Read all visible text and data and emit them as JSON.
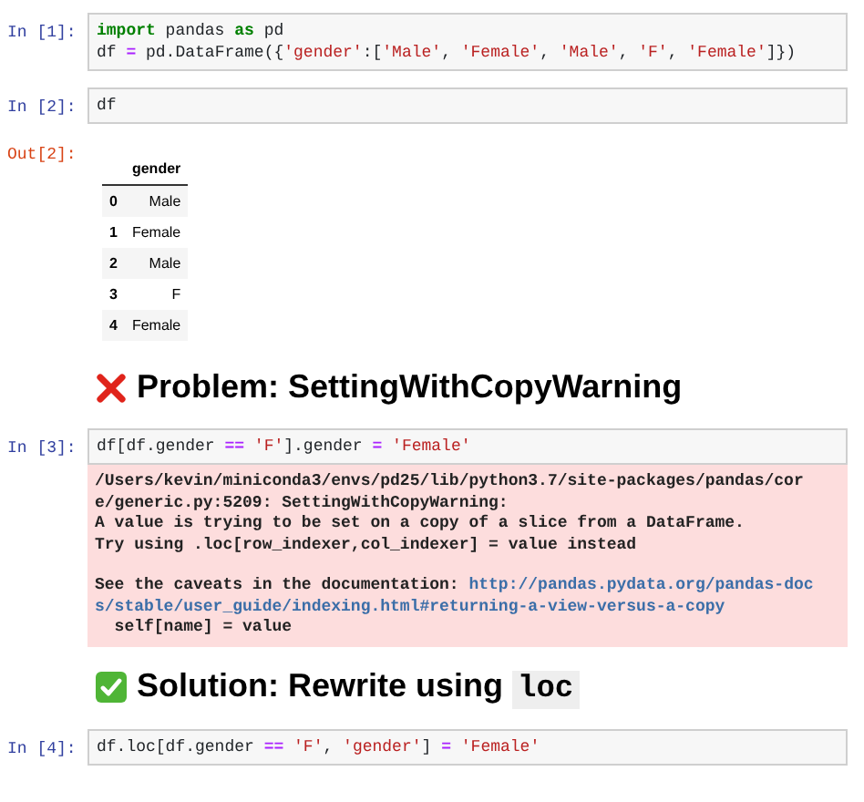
{
  "cells": [
    {
      "kind": "code",
      "prompt": "In [1]:",
      "lines": [
        [
          {
            "text": "import",
            "kind": "keyword"
          },
          {
            "text": " pandas ",
            "kind": "plain"
          },
          {
            "text": "as",
            "kind": "keyword"
          },
          {
            "text": " pd",
            "kind": "plain"
          }
        ],
        [
          {
            "text": "df ",
            "kind": "plain"
          },
          {
            "text": "=",
            "kind": "operator"
          },
          {
            "text": " pd.DataFrame({",
            "kind": "plain"
          },
          {
            "text": "'gender'",
            "kind": "string"
          },
          {
            "text": ":[",
            "kind": "plain"
          },
          {
            "text": "'Male'",
            "kind": "string"
          },
          {
            "text": ", ",
            "kind": "plain"
          },
          {
            "text": "'Female'",
            "kind": "string"
          },
          {
            "text": ", ",
            "kind": "plain"
          },
          {
            "text": "'Male'",
            "kind": "string"
          },
          {
            "text": ", ",
            "kind": "plain"
          },
          {
            "text": "'F'",
            "kind": "string"
          },
          {
            "text": ", ",
            "kind": "plain"
          },
          {
            "text": "'Female'",
            "kind": "string"
          },
          {
            "text": "]})",
            "kind": "plain"
          }
        ]
      ]
    },
    {
      "kind": "code",
      "prompt": "In [2]:",
      "lines": [
        [
          {
            "text": "df",
            "kind": "plain"
          }
        ]
      ],
      "output": {
        "prompt": "Out[2]:",
        "kind": "table",
        "columns": [
          "gender"
        ],
        "rows": [
          {
            "index": "0",
            "values": [
              "Male"
            ]
          },
          {
            "index": "1",
            "values": [
              "Female"
            ]
          },
          {
            "index": "2",
            "values": [
              "Male"
            ]
          },
          {
            "index": "3",
            "values": [
              "F"
            ]
          },
          {
            "index": "4",
            "values": [
              "Female"
            ]
          }
        ]
      }
    },
    {
      "kind": "problem",
      "parts": [
        {
          "text": "Problem: SettingWithCopyWarning",
          "kind": "plain"
        }
      ]
    },
    {
      "kind": "code",
      "prompt": "In [3]:",
      "lines": [
        [
          {
            "text": "df[df.gender ",
            "kind": "plain"
          },
          {
            "text": "== ",
            "kind": "operator"
          },
          {
            "text": "'F'",
            "kind": "string"
          },
          {
            "text": "].gender ",
            "kind": "plain"
          },
          {
            "text": "= ",
            "kind": "operator"
          },
          {
            "text": "'Female'",
            "kind": "string"
          }
        ]
      ],
      "output": {
        "kind": "stderr",
        "paragraphs": [
          [
            [
              {
                "text": "/Users/kevin/miniconda3/envs/pd25/lib/python3.7/site-packages/pandas/cor",
                "kind": "plain"
              }
            ],
            [
              {
                "text": "e/generic.py:5209: SettingWithCopyWarning:",
                "kind": "plain"
              }
            ],
            [
              {
                "text": "A value is trying to be set on a copy of a slice from a DataFrame.",
                "kind": "plain"
              }
            ],
            [
              {
                "text": "Try using .loc[row_indexer,col_indexer] = value instead",
                "kind": "plain"
              }
            ]
          ],
          [
            [
              {
                "text": "See the caveats in the documentation: ",
                "kind": "plain"
              },
              {
                "text": "http://pandas.pydata.org/pandas-doc",
                "kind": "link"
              }
            ],
            [
              {
                "text": "s/stable/user_guide/indexing.html#returning-a-view-versus-a-copy",
                "kind": "link"
              }
            ],
            [
              {
                "text": "  self[name] = value",
                "kind": "plain"
              }
            ]
          ]
        ]
      }
    },
    {
      "kind": "solution",
      "parts": [
        {
          "text": "Solution: Rewrite using ",
          "kind": "plain"
        },
        {
          "text": "loc",
          "kind": "code"
        }
      ]
    },
    {
      "kind": "code",
      "prompt": "In [4]:",
      "lines": [
        [
          {
            "text": "df.loc[df.gender ",
            "kind": "plain"
          },
          {
            "text": "== ",
            "kind": "operator"
          },
          {
            "text": "'F'",
            "kind": "string"
          },
          {
            "text": ", ",
            "kind": "plain"
          },
          {
            "text": "'gender'",
            "kind": "string"
          },
          {
            "text": "] ",
            "kind": "plain"
          },
          {
            "text": "= ",
            "kind": "operator"
          },
          {
            "text": "'Female'",
            "kind": "string"
          }
        ]
      ]
    }
  ]
}
